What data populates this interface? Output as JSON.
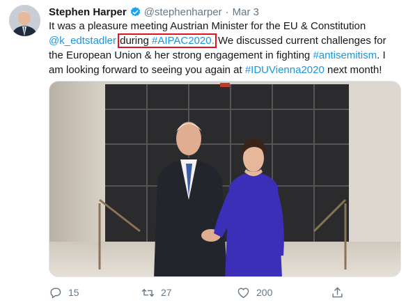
{
  "tweet": {
    "author_name": "Stephen Harper",
    "handle": "@stephenharper",
    "separator": "·",
    "date": "Mar 3",
    "text": {
      "part1": "It was a pleasure meeting Austrian Minister for the EU & Constitution ",
      "mention": "@k_edtstadler",
      "boxed_word": "during ",
      "hashtag1": "#AIPAC2020.",
      "part2": " We discussed current challenges for the European Union & her strong engagement in fighting ",
      "hashtag2": "#antisemitism",
      "part3": ". I am looking forward to seeing you again at ",
      "hashtag3": "#IDUVienna2020",
      "part4": " next month!"
    },
    "actions": {
      "reply_count": "15",
      "retweet_count": "27",
      "like_count": "200"
    },
    "colors": {
      "link": "#1b95e0",
      "highlight_box": "#e0141e",
      "secondary_text": "#657786"
    },
    "icons": [
      "verified-badge-icon",
      "reply-icon",
      "retweet-icon",
      "like-icon",
      "share-icon"
    ]
  }
}
